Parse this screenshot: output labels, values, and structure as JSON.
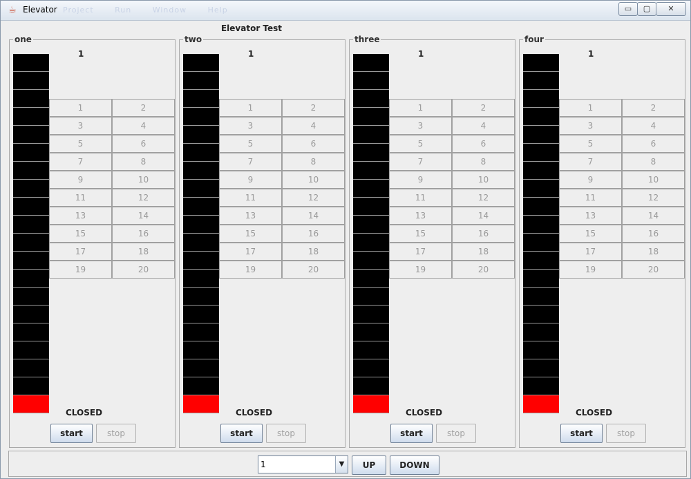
{
  "window": {
    "title": "Elevator",
    "menu_ghost": [
      "Project",
      "Run",
      "Window",
      "Help"
    ],
    "controls": {
      "minimize": "▭",
      "maximize": "▢",
      "close": "✕"
    }
  },
  "app_title": "Elevator Test",
  "elevators": [
    {
      "name": "one",
      "current_floor": "1",
      "door_status": "CLOSED",
      "start_label": "start",
      "stop_label": "stop"
    },
    {
      "name": "two",
      "current_floor": "1",
      "door_status": "CLOSED",
      "start_label": "start",
      "stop_label": "stop"
    },
    {
      "name": "three",
      "current_floor": "1",
      "door_status": "CLOSED",
      "start_label": "start",
      "stop_label": "stop"
    },
    {
      "name": "four",
      "current_floor": "1",
      "door_status": "CLOSED",
      "start_label": "start",
      "stop_label": "stop"
    }
  ],
  "floor_buttons": [
    "1",
    "2",
    "3",
    "4",
    "5",
    "6",
    "7",
    "8",
    "9",
    "10",
    "11",
    "12",
    "13",
    "14",
    "15",
    "16",
    "17",
    "18",
    "19",
    "20"
  ],
  "shaft": {
    "floors": 20,
    "active_floor": 1,
    "active_color": "#ff0000",
    "idle_color": "#000000"
  },
  "controls": {
    "floor_select_value": "1",
    "up_label": "UP",
    "down_label": "DOWN"
  }
}
